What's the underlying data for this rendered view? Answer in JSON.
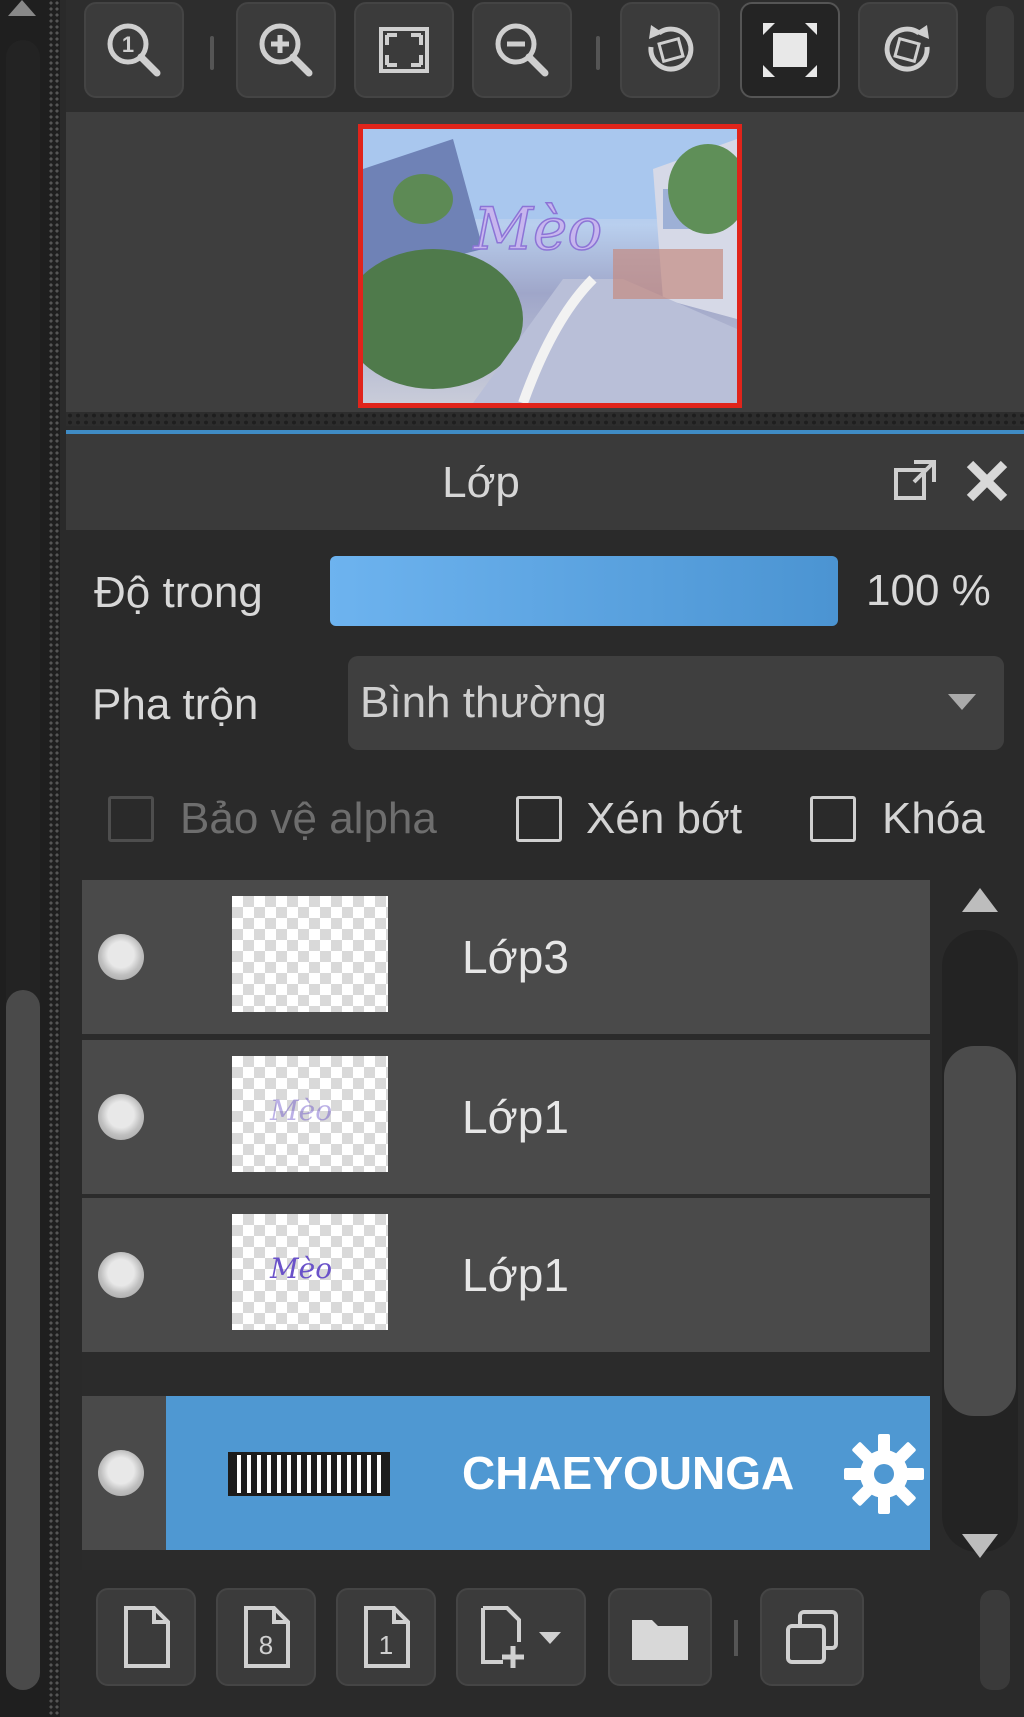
{
  "navigator": {
    "toolbar": [
      {
        "icon": "zoom-actual-size-icon"
      },
      {
        "icon": "zoom-in-icon"
      },
      {
        "icon": "fit-to-window-icon"
      },
      {
        "icon": "zoom-out-icon"
      },
      {
        "icon": "rotate-left-icon"
      },
      {
        "icon": "flip-canvas-icon",
        "active": true
      },
      {
        "icon": "rotate-right-icon"
      }
    ],
    "preview_frame_color": "#e0241b"
  },
  "layer_panel": {
    "title": "Lớp",
    "opacity_label": "Độ trong",
    "opacity_value": "100 %",
    "opacity_fraction": 1.0,
    "blend_label": "Pha trộn",
    "blend_value": "Bình thường",
    "checkboxes": {
      "alpha_protect": "Bảo vệ alpha",
      "clip": "Xén bớt",
      "lock": "Khóa"
    },
    "layers": [
      {
        "name": "Lớp3",
        "thumb": "transparent",
        "selected": false
      },
      {
        "name": "Lớp1",
        "thumb": "signature-faint",
        "selected": false
      },
      {
        "name": "Lớp1",
        "thumb": "signature",
        "selected": false
      },
      {
        "name": "CHAEYOUNGA",
        "thumb": "text-layer",
        "selected": true,
        "icon": "gear-icon"
      }
    ],
    "selected_color": "#4f98d2"
  },
  "bottom_toolbar": [
    {
      "icon": "new-layer-icon"
    },
    {
      "icon": "new-8bit-layer-icon"
    },
    {
      "icon": "new-1bit-layer-icon"
    },
    {
      "icon": "add-layer-dropdown-icon"
    },
    {
      "icon": "new-folder-icon"
    },
    {
      "icon": "duplicate-layer-icon"
    }
  ]
}
